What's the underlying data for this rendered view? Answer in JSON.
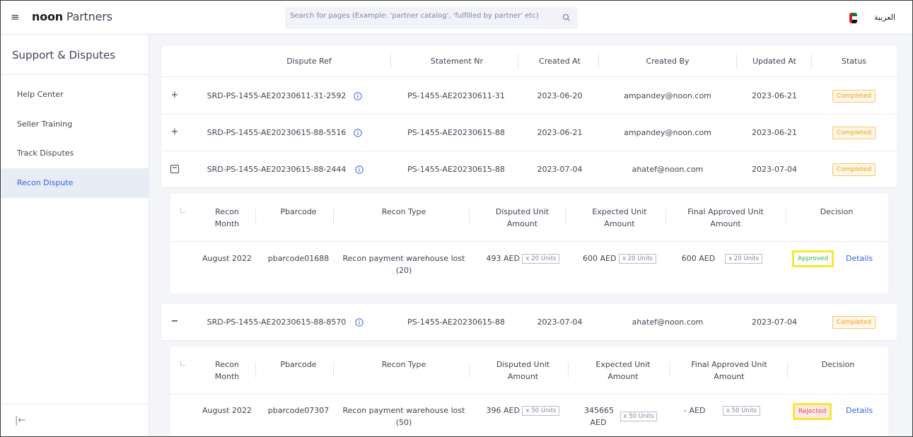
{
  "header": {
    "menu_icon": "hamburger-icon",
    "brand_bold": "noon",
    "brand_rest": "Partners",
    "search_placeholder": "Search for pages (Example: 'partner catalog', 'fulfilled by partner' etc)",
    "language": "العربية",
    "flag": "uae-flag-icon"
  },
  "sidebar": {
    "title": "Support & Disputes",
    "items": [
      {
        "label": "Help Center"
      },
      {
        "label": "Seller Training"
      },
      {
        "label": "Track Disputes"
      },
      {
        "label": "Recon Dispute",
        "active": true
      }
    ],
    "collapse_icon": "|←"
  },
  "table": {
    "columns": [
      "Dispute Ref",
      "Statement Nr",
      "Created At",
      "Created By",
      "Updated At",
      "Status"
    ],
    "rows": [
      {
        "expand": "+",
        "ref": "SRD-PS-1455-AE20230611-31-2592",
        "statement": "PS-1455-AE20230611-31",
        "created_at": "2023-06-20",
        "created_by": "ampandey@noon.com",
        "updated_at": "2023-06-21",
        "status": "Completed"
      },
      {
        "expand": "+",
        "ref": "SRD-PS-1455-AE20230615-88-5516",
        "statement": "PS-1455-AE20230615-88",
        "created_at": "2023-06-21",
        "created_by": "ampandey@noon.com",
        "updated_at": "2023-06-21",
        "status": "Completed"
      },
      {
        "expand": "−",
        "ref": "SRD-PS-1455-AE20230615-88-2444",
        "statement": "PS-1455-AE20230615-88",
        "created_at": "2023-07-04",
        "created_by": "ahatef@noon.com",
        "updated_at": "2023-07-04",
        "status": "Completed"
      },
      {
        "expand": "−",
        "ref": "SRD-PS-1455-AE20230615-88-8570",
        "statement": "PS-1455-AE20230615-88",
        "created_at": "2023-07-04",
        "created_by": "ahatef@noon.com",
        "updated_at": "2023-07-04",
        "status": "Completed"
      }
    ],
    "sub_columns": {
      "recon_month": [
        "Recon",
        "Month"
      ],
      "pbarcode": "Pbarcode",
      "recon_type": "Recon Type",
      "disputed": [
        "Disputed Unit",
        "Amount"
      ],
      "expected": [
        "Expected Unit",
        "Amount"
      ],
      "final": [
        "Final Approved Unit",
        "Amount"
      ],
      "decision": "Decision"
    },
    "sub_rows": [
      {
        "month": "August 2022",
        "pbarcode": "pbarcode01688",
        "recon_type_1": "Recon payment warehouse lost",
        "recon_type_2": "(20)",
        "disputed_amt": "493 AED",
        "disputed_units": "x 20 Units",
        "expected_amt": "600 AED",
        "expected_units": "x 20 Units",
        "final_amt": "600 AED",
        "final_units": "x 20 Units",
        "decision": "Approved",
        "details": "Details"
      },
      {
        "month": "August 2022",
        "pbarcode": "pbarcode07307",
        "recon_type_1": "Recon payment warehouse lost",
        "recon_type_2": "(50)",
        "disputed_amt": "396 AED",
        "disputed_units": "x 50 Units",
        "expected_amt_1": "345665",
        "expected_amt_2": "AED",
        "expected_units": "x 50 Units",
        "final_amt": "- AED",
        "final_units": "x 50 Units",
        "decision": "Rejected",
        "details": "Details"
      }
    ]
  },
  "colors": {
    "accent": "#3866df",
    "completed": "#f29b0a",
    "approved": "#37b24d",
    "rejected": "#e5484d",
    "highlight": "#f5e934"
  }
}
